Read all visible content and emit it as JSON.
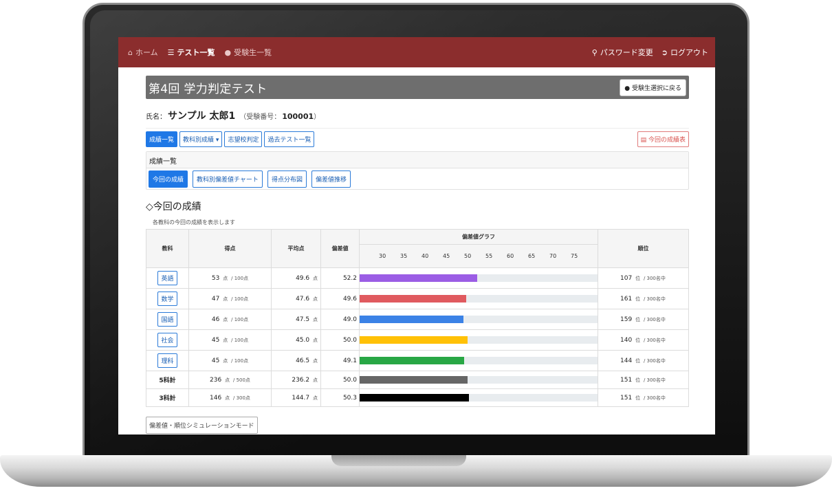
{
  "nav": {
    "home": "ホーム",
    "tests": "テスト一覧",
    "students": "受験生一覧",
    "password": "パスワード変更",
    "logout": "ログアウト"
  },
  "page": {
    "title": "第4回 学力判定テスト",
    "back_button": "受験生選択に戻る",
    "name_label": "氏名：",
    "student_name": "サンプル 太郎1",
    "exam_label": "（受験番号：",
    "exam_number": "100001",
    "exam_close": "）"
  },
  "tabs": {
    "results": "成績一覧",
    "subjects": "教科別成績",
    "school": "志望校判定",
    "past": "過去テスト一覧",
    "report": "今回の成績表"
  },
  "card": {
    "header": "成績一覧",
    "current": "今回の成績",
    "chart": "教科別偏差値チャート",
    "distribution": "得点分布図",
    "trend": "偏差値推移"
  },
  "section": {
    "title": "◇今回の成績",
    "subtitle": "各教科の今回の成績を表示します"
  },
  "table": {
    "headers": {
      "subject": "教科",
      "score": "得点",
      "average": "平均点",
      "deviation": "偏差値",
      "graph": "偏差値グラフ",
      "rank": "順位"
    },
    "ticks": [
      "30",
      "35",
      "40",
      "45",
      "50",
      "55",
      "60",
      "65",
      "70",
      "75"
    ],
    "rows": [
      {
        "subject": "英語",
        "score": "53",
        "score_unit": "点",
        "max": "/ 100点",
        "average": "49.6",
        "avg_unit": "点",
        "deviation": "52.2",
        "rank": "107",
        "rank_unit": "位",
        "rank_total": "/ 300名中",
        "color": "#9b5de5"
      },
      {
        "subject": "数学",
        "score": "47",
        "score_unit": "点",
        "max": "/ 100点",
        "average": "47.6",
        "avg_unit": "点",
        "deviation": "49.6",
        "rank": "161",
        "rank_unit": "位",
        "rank_total": "/ 300名中",
        "color": "#e05a5f"
      },
      {
        "subject": "国語",
        "score": "46",
        "score_unit": "点",
        "max": "/ 100点",
        "average": "47.5",
        "avg_unit": "点",
        "deviation": "49.0",
        "rank": "159",
        "rank_unit": "位",
        "rank_total": "/ 300名中",
        "color": "#3b82e6"
      },
      {
        "subject": "社会",
        "score": "45",
        "score_unit": "点",
        "max": "/ 100点",
        "average": "45.0",
        "avg_unit": "点",
        "deviation": "50.0",
        "rank": "140",
        "rank_unit": "位",
        "rank_total": "/ 300名中",
        "color": "#ffc107"
      },
      {
        "subject": "理科",
        "score": "45",
        "score_unit": "点",
        "max": "/ 100点",
        "average": "46.5",
        "avg_unit": "点",
        "deviation": "49.1",
        "rank": "144",
        "rank_unit": "位",
        "rank_total": "/ 300名中",
        "color": "#28a745"
      }
    ],
    "totals": [
      {
        "subject": "5科計",
        "score": "236",
        "score_unit": "点",
        "max": "/ 500点",
        "average": "236.2",
        "avg_unit": "点",
        "deviation": "50.0",
        "rank": "151",
        "rank_unit": "位",
        "rank_total": "/ 300名中",
        "color": "#666666"
      },
      {
        "subject": "3科計",
        "score": "146",
        "score_unit": "点",
        "max": "/ 300点",
        "average": "144.7",
        "avg_unit": "点",
        "deviation": "50.3",
        "rank": "151",
        "rank_unit": "位",
        "rank_total": "/ 300名中",
        "color": "#000000"
      }
    ]
  },
  "simulation_button": "偏差値・順位シミュレーションモード"
}
